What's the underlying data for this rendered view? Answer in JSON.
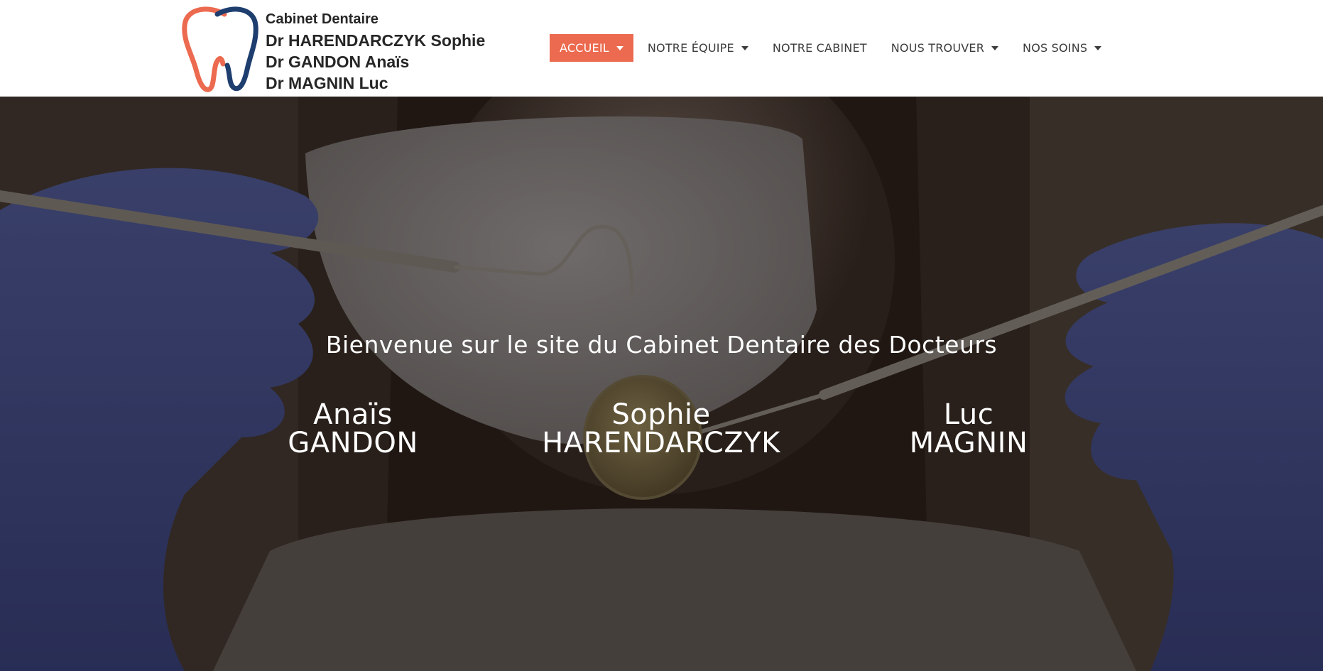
{
  "logo": {
    "line1": "Cabinet Dentaire",
    "line2": "Dr HARENDARCZYK Sophie",
    "line3": "Dr GANDON Anaïs",
    "line4": "Dr MAGNIN Luc",
    "icon": "tooth-icon",
    "colors": {
      "orange": "#ec6a4f",
      "navy": "#1d3e6e"
    }
  },
  "nav": {
    "items": [
      {
        "label": "ACCUEIL",
        "active": true,
        "has_dropdown": true
      },
      {
        "label": "NOTRE ÉQUIPE",
        "active": false,
        "has_dropdown": true
      },
      {
        "label": "NOTRE CABINET",
        "active": false,
        "has_dropdown": false
      },
      {
        "label": "NOUS TROUVER",
        "active": false,
        "has_dropdown": true
      },
      {
        "label": "NOS SOINS",
        "active": false,
        "has_dropdown": true
      }
    ],
    "active_color": "#ec6a4f",
    "text_color": "#3b3b3b"
  },
  "hero": {
    "welcome": "Bienvenue sur le site du Cabinet Dentaire des Docteurs",
    "doctors": [
      {
        "first": "Anaïs",
        "last": "GANDON"
      },
      {
        "first": "Sophie",
        "last": "HARENDARCZYK"
      },
      {
        "first": "Luc",
        "last": "MAGNIN"
      }
    ]
  }
}
